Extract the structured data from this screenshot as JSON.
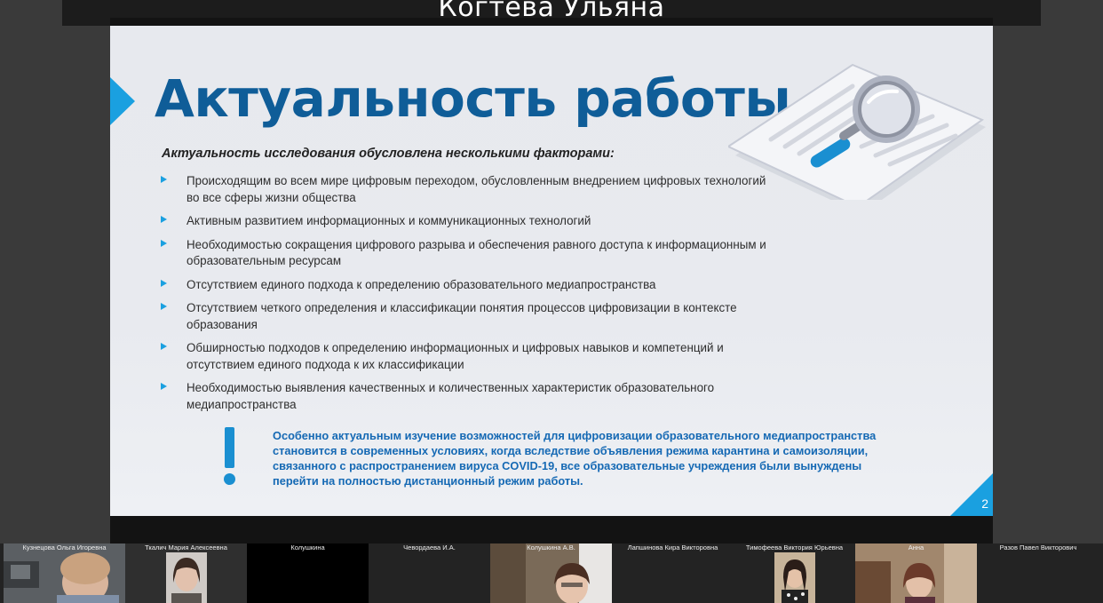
{
  "speaker": {
    "name": "Когтева Ульяна"
  },
  "slide": {
    "title": "Актуальность работы",
    "subtitle": "Актуальность исследования обусловлена несколькими факторами:",
    "factors": [
      {
        "line1": "Происходящим во всем мире цифровым переходом, обусловленным внедрением цифровых технологий",
        "line2": "во все сферы жизни общества"
      },
      {
        "line1": "Активным развитием информационных и коммуникационных технологий",
        "line2": ""
      },
      {
        "line1": "Необходимостью сокращения цифрового разрыва и обеспечения равного доступа к информационным и",
        "line2": "образовательным ресурсам"
      },
      {
        "line1": "Отсутствием единого подхода к определению образовательного медиапространства",
        "line2": ""
      },
      {
        "line1": "Отсутствием четкого определения и классификации понятия процессов цифровизации в контексте",
        "line2": "образования"
      },
      {
        "line1": "Обширностью подходов к определению информационных и цифровых навыков и компетенций и",
        "line2": "отсутствием единого подхода к их классификации"
      },
      {
        "line1": "Необходимостью выявления качественных и количественных характеристик образовательного",
        "line2": "медиапространства"
      }
    ],
    "note_lines": [
      "Особенно актуальным изучение возможностей для цифровизации образовательного медиапространства",
      "становится в современных условиях, когда вследствие объявления режима карантина и самоизоляции,",
      "связанного с распространением вируса COVID-19, все образовательные учреждения были вынуждены",
      "перейти на полностью дистанционный режим работы."
    ],
    "page_number": "2"
  },
  "participants": [
    {
      "name": "Кузнецова Ольга Игоревна",
      "video": "on"
    },
    {
      "name": "Ткалич Мария Алексеевна",
      "video": "on"
    },
    {
      "name": "Колушкина",
      "video": "off"
    },
    {
      "name": "Чевордаева И.А.",
      "video": "off"
    },
    {
      "name": "Колушкина А.В.",
      "video": "on"
    },
    {
      "name": "Лапшинова Кира Викторовна",
      "video": "off"
    },
    {
      "name": "Тимофеева Виктория Юрьевна",
      "video": "on"
    },
    {
      "name": "Анна",
      "video": "on"
    },
    {
      "name": "Разов Павел Викторович",
      "video": "off"
    }
  ],
  "colors": {
    "accent": "#1aa0e0",
    "title": "#0f5d98",
    "note": "#1569b4"
  }
}
